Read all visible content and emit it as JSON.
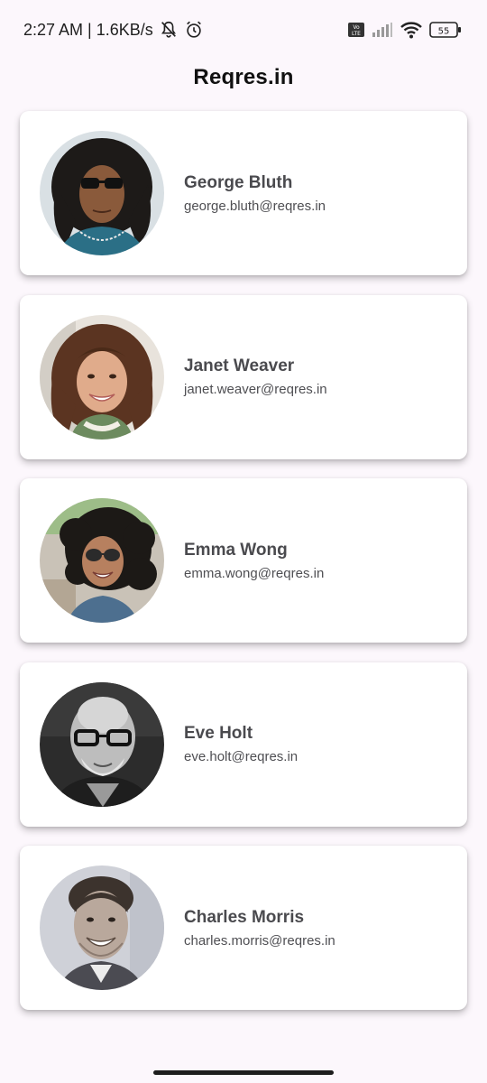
{
  "status_bar": {
    "time_speed": "2:27 AM | 1.6KB/s",
    "battery": "55",
    "network_badge": "Vo LTE",
    "icons": [
      "bell-muted-icon",
      "alarm-icon",
      "volte-icon",
      "signal-icon",
      "wifi-icon",
      "battery-icon"
    ]
  },
  "app_bar": {
    "title": "Reqres.in"
  },
  "users": [
    {
      "name": "George Bluth",
      "email": "george.bluth@reqres.in",
      "avatar": "george-avatar"
    },
    {
      "name": "Janet Weaver",
      "email": "janet.weaver@reqres.in",
      "avatar": "janet-avatar"
    },
    {
      "name": "Emma Wong",
      "email": "emma.wong@reqres.in",
      "avatar": "emma-avatar"
    },
    {
      "name": "Eve Holt",
      "email": "eve.holt@reqres.in",
      "avatar": "eve-avatar"
    },
    {
      "name": "Charles Morris",
      "email": "charles.morris@reqres.in",
      "avatar": "charles-avatar"
    }
  ],
  "colors": {
    "background": "#fcf7fc",
    "card": "#ffffff",
    "name_text": "#4a4a4e"
  }
}
